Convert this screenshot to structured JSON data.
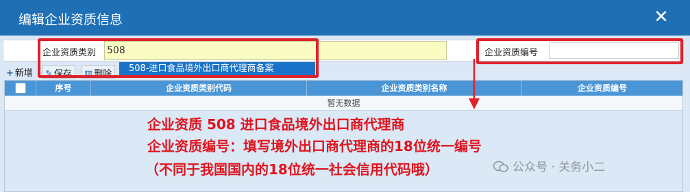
{
  "dialog": {
    "title": "编辑企业资质信息",
    "close_glyph": "✕"
  },
  "form": {
    "type_label": "企业资质类别",
    "type_value": "508",
    "code_label": "企业资质编号",
    "code_value": "",
    "dropdown_option": "508-进口食品境外出口商代理商备案"
  },
  "toolbar": {
    "add_label": "新增",
    "save_label": "保存",
    "delete_label": "删除"
  },
  "table": {
    "columns": [
      "序号",
      "企业资质类别代码",
      "企业资质类别名称",
      "企业资质编号"
    ],
    "empty_text": "暂无数据"
  },
  "annotation": {
    "line1": "企业资质 508 进口食品境外出口商代理商",
    "line2": "企业资质编号：填写境外出口商代理商的18位统一编号",
    "line3": "（不同于我国国内的18位统一社会信用代码哦）"
  },
  "watermark": {
    "text": "公众号 · 关务小二"
  },
  "colors": {
    "titlebar": "#1f6fb5",
    "header": "#4a95d6",
    "highlight_red": "#e0202a",
    "input_yellow": "#fafcc4",
    "selected_option": "#1a73c8"
  },
  "icons": {
    "close": "close-icon",
    "add": "plus-icon",
    "save": "edit-icon",
    "delete": "trash-icon"
  }
}
